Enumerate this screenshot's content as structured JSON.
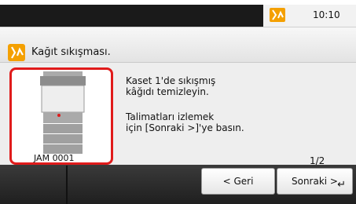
{
  "status_bar": {
    "time": "10:10"
  },
  "header": {
    "title": "Kağıt sıkışması."
  },
  "image": {
    "caption": "JAM 0001"
  },
  "message": {
    "line1": "Kaset 1'de sıkışmış",
    "line2": "kâğıdı temizleyin.",
    "line3": "Talimatları izlemek",
    "line4": "için [Sonraki >]'ye basın."
  },
  "pagination": {
    "page": "1/2"
  },
  "buttons": {
    "back": "< Geri",
    "next": "Sonraki >"
  },
  "colors": {
    "accent": "#f4a000",
    "highlight": "#e01b1b"
  }
}
